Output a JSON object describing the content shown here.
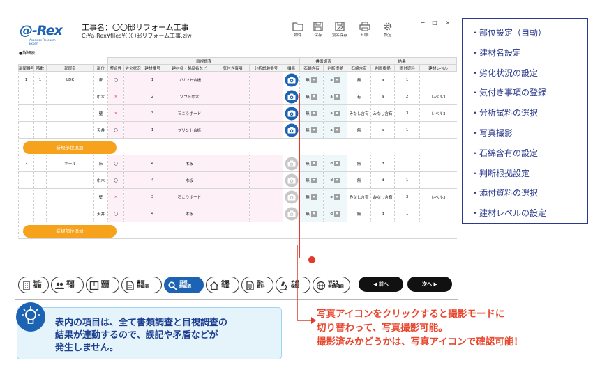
{
  "app": {
    "logo_text": "@-Rex",
    "logo_sub": "Asbestos Research Expert",
    "project_title": "工事名：〇〇邸リフォーム工事",
    "file_path": "C:¥a-Rex¥files¥〇〇邸リフォーム工事.ziw",
    "toolbar": [
      {
        "label": "物件",
        "icon": "folder-icon"
      },
      {
        "label": "保存",
        "icon": "save-icon"
      },
      {
        "label": "別名保存",
        "icon": "save-as-icon"
      },
      {
        "label": "印刷",
        "icon": "print-icon"
      },
      {
        "label": "設定",
        "icon": "gear-icon"
      }
    ],
    "window_controls": [
      "−",
      "□",
      "×"
    ]
  },
  "section_title": "●詳細表",
  "table": {
    "group_headers": [
      "目視調査",
      "書面調査",
      "結果"
    ],
    "columns": [
      "部屋番号",
      "階数",
      "部屋名",
      "部位",
      "整合性",
      "劣化状況",
      "建材番号",
      "建材名・製品名など",
      "気付き事項",
      "分析試験番号",
      "撮影",
      "石綿含有",
      "判断根拠",
      "石綿含有",
      "判断根拠",
      "添付資料",
      "建材レベル"
    ],
    "groups": [
      {
        "rows": [
          {
            "room_no": "1",
            "floor": "1",
            "room": "LDK",
            "part": "床",
            "check": "〇",
            "num": "1",
            "name": "プリント合板",
            "photo": "taken",
            "doc_asb": "無",
            "doc_basis": "a",
            "res_asb": "無",
            "res_basis": "a",
            "attach": "1",
            "level": ""
          },
          {
            "room_no": "",
            "floor": "",
            "room": "",
            "part": "巾木",
            "check": "×",
            "num": "2",
            "name": "ソフト巾木",
            "photo": "taken",
            "doc_asb": "無",
            "doc_basis": "a",
            "res_asb": "有",
            "res_basis": "a",
            "attach": "2",
            "level": "レベル3"
          },
          {
            "room_no": "",
            "floor": "",
            "room": "",
            "part": "壁",
            "check": "×",
            "num": "3",
            "name": "石こうボード",
            "photo": "taken",
            "doc_asb": "無",
            "doc_basis": "a",
            "res_asb": "みなし含有",
            "res_basis": "みなし含有",
            "attach": "3",
            "level": "レベル3"
          },
          {
            "room_no": "",
            "floor": "",
            "room": "",
            "part": "天井",
            "check": "〇",
            "num": "1",
            "name": "プリント合板",
            "photo": "taken",
            "doc_asb": "無",
            "doc_basis": "a",
            "res_asb": "無",
            "res_basis": "a",
            "attach": "1",
            "level": ""
          }
        ],
        "add_label": "新規部位追加"
      },
      {
        "rows": [
          {
            "room_no": "2",
            "floor": "1",
            "room": "ホール",
            "part": "床",
            "check": "〇",
            "num": "4",
            "name": "木板",
            "photo": "none",
            "doc_asb": "無",
            "doc_basis": "d",
            "res_asb": "無",
            "res_basis": "d",
            "attach": "1",
            "level": ""
          },
          {
            "room_no": "",
            "floor": "",
            "room": "",
            "part": "巾木",
            "check": "〇",
            "num": "4",
            "name": "木板",
            "photo": "none",
            "doc_asb": "無",
            "doc_basis": "d",
            "res_asb": "無",
            "res_basis": "d",
            "attach": "1",
            "level": ""
          },
          {
            "room_no": "",
            "floor": "",
            "room": "",
            "part": "壁",
            "check": "×",
            "num": "3",
            "name": "石こうボード",
            "photo": "none",
            "doc_asb": "無",
            "doc_basis": "a",
            "res_asb": "みなし含有",
            "res_basis": "みなし含有",
            "attach": "3",
            "level": "レベル3"
          },
          {
            "room_no": "",
            "floor": "",
            "room": "",
            "part": "天井",
            "check": "〇",
            "num": "4",
            "name": "木板",
            "photo": "none",
            "doc_asb": "無",
            "doc_basis": "d",
            "res_asb": "無",
            "res_basis": "d",
            "attach": "1",
            "level": ""
          }
        ],
        "add_label": "新規部位追加"
      }
    ]
  },
  "nav": [
    {
      "label": "物件\n情報",
      "icon": "building-icon"
    },
    {
      "label": "元請\n下請",
      "icon": "people-icon"
    },
    {
      "label": "図面\n部屋",
      "icon": "floorplan-icon"
    },
    {
      "label": "書面\n詳細表",
      "icon": "document-icon"
    },
    {
      "label": "目視\n詳細表",
      "icon": "magnifier-icon",
      "active": true
    },
    {
      "label": "外観\n写真",
      "icon": "house-icon"
    },
    {
      "label": "添付\n資料",
      "icon": "attachment-icon"
    },
    {
      "label": "分析\n採取",
      "icon": "microscope-icon"
    },
    {
      "label": "WEB\n申請項目",
      "icon": "globe-icon"
    }
  ],
  "prev_label": "◀ 前へ",
  "next_label": "次へ ▶",
  "feature_list": [
    "部位設定（自動）",
    "建材名設定",
    "劣化状況の設定",
    "気付き事項の登録",
    "分析試料の選択",
    "写真撮影",
    "石綿含有の設定",
    "判断根拠設定",
    "添付資料の選択",
    "建材レベルの設定"
  ],
  "info_text": "表内の項目は、全て書類調査と目視調査の\n結果が連動するので、誤記や矛盾などが\n発生しません。",
  "note_text": "写真アイコンをクリックすると撮影モードに\n切り替わって、写真撮影可能。\n撮影済みかどうかは、写真アイコンで確認可能！",
  "colors": {
    "brand": "#1c63b4",
    "accent": "#f7a21c",
    "highlight": "#e23b2e",
    "list": "#2b3a8c"
  }
}
